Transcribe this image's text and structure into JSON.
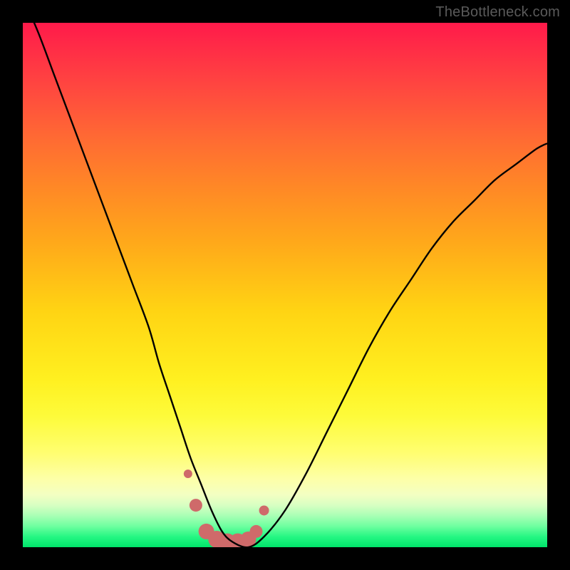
{
  "watermark": "TheBottleneck.com",
  "colors": {
    "frame": "#000000",
    "curve": "#000000",
    "marker": "#cf6a6a",
    "gradient_top": "#ff1a4a",
    "gradient_bottom": "#00e46a"
  },
  "chart_data": {
    "type": "line",
    "title": "",
    "xlabel": "",
    "ylabel": "",
    "xlim": [
      0,
      100
    ],
    "ylim": [
      0,
      100
    ],
    "grid": false,
    "legend": false,
    "annotations": [],
    "series": [
      {
        "name": "bottleneck-curve",
        "x": [
          0,
          3,
          6,
          9,
          12,
          15,
          18,
          21,
          24,
          26,
          28,
          30,
          32,
          34,
          36,
          38,
          40,
          43,
          46,
          50,
          54,
          58,
          62,
          66,
          70,
          74,
          78,
          82,
          86,
          90,
          94,
          98,
          100
        ],
        "y": [
          105,
          98,
          90,
          82,
          74,
          66,
          58,
          50,
          42,
          35,
          29,
          23,
          17,
          12,
          7,
          3,
          1,
          0,
          2,
          7,
          14,
          22,
          30,
          38,
          45,
          51,
          57,
          62,
          66,
          70,
          73,
          76,
          77
        ]
      }
    ],
    "markers": {
      "name": "highlight-points",
      "x": [
        31.5,
        33,
        35,
        37,
        39,
        41,
        43,
        44.5,
        46
      ],
      "y": [
        14,
        8,
        3,
        1.5,
        1,
        1,
        1.5,
        3,
        7
      ],
      "r": [
        6,
        9,
        11,
        12,
        12,
        12,
        11,
        9,
        7
      ]
    }
  }
}
